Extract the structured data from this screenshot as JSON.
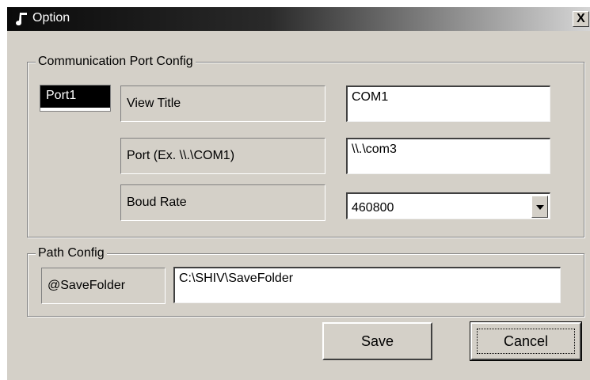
{
  "window": {
    "title": "Option",
    "close_label": "X"
  },
  "comm_group": {
    "label": "Communication Port Config",
    "port_tab": "Port1",
    "view_title_label": "View Title",
    "view_title_value": "COM1",
    "port_label": "Port (Ex. \\\\.\\COM1)",
    "port_value": "\\\\.\\com3",
    "baud_label": "Boud Rate",
    "baud_value": "460800"
  },
  "path_group": {
    "label": "Path Config",
    "save_folder_label": "@SaveFolder",
    "save_folder_value": "C:\\SHIV\\SaveFolder"
  },
  "buttons": {
    "save": "Save",
    "cancel": "Cancel"
  },
  "icons": {
    "title": "music-note-icon",
    "dropdown": "chevron-down-icon"
  }
}
